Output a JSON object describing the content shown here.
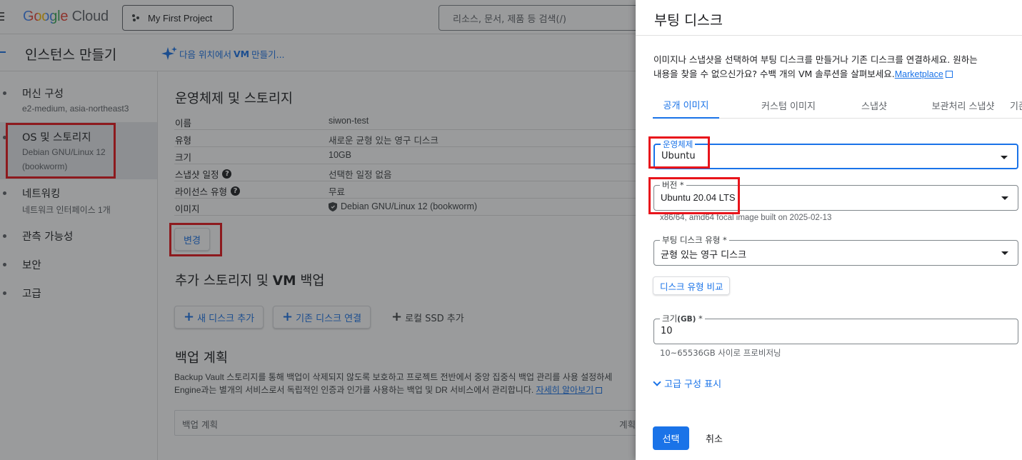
{
  "topbar": {
    "logo_google": "Google",
    "logo_cloud": "Cloud",
    "project": "My First Project",
    "search_placeholder": "리소스, 문서, 제품 등 검색(/)"
  },
  "subbar": {
    "title": "인스턴스 만들기",
    "ai_link_prefix": "다음 위치에서 ",
    "ai_link_bold": "VM",
    "ai_link_suffix": " 만들기..."
  },
  "leftnav": {
    "items": [
      {
        "title": "머신 구성",
        "sub": "e2-medium, asia-northeast3"
      },
      {
        "title": "OS 및 스토리지",
        "sub": "Debian GNU/Linux 12",
        "sub2": "(bookworm)"
      },
      {
        "title": "네트워킹",
        "sub": "네트워크 인터페이스 1개"
      },
      {
        "title": "관측 가능성"
      },
      {
        "title": "보안"
      },
      {
        "title": "고급"
      }
    ]
  },
  "content": {
    "os_title": "운영체제 및 스토리지",
    "specs": [
      {
        "key": "이름",
        "value": "siwon-test"
      },
      {
        "key": "유형",
        "value": "새로운 균형 있는 영구 디스크"
      },
      {
        "key": "크기",
        "value": "10GB"
      },
      {
        "key": "스냅샷 일정",
        "value": "선택한 일정 없음"
      },
      {
        "key": "라이선스 유형",
        "value": "무료"
      },
      {
        "key": "이미지",
        "value": "Debian GNU/Linux 12 (bookworm)"
      }
    ],
    "change_button": "변경",
    "storage_title_prefix": "추가 스토리지 및 ",
    "storage_title_bold": "VM",
    "storage_title_suffix": " 백업",
    "add_disk": "새 디스크 추가",
    "attach_disk": "기존 디스크 연결",
    "add_ssd": "로컬 SSD 추가",
    "backup_title": "백업 계획",
    "backup_desc_line1": "Backup Vault 스토리지를 통해 백업이 삭제되지 않도록 보호하고 프로젝트 전반에서 중앙 집중식 백업 관리를 사용 설정하세",
    "backup_desc_line2": "Engine과는 별개의 서비스로서 독립적인 인증과 인가를 사용하는 백업 및 DR 서비스에서 관리합니다.",
    "learn_more": "자세히 알아보기",
    "table_col1": "백업 계획",
    "table_col2": "계획"
  },
  "panel": {
    "title": "부팅 디스크",
    "desc_line1": "이미지나 스냅샷을 선택하여 부팅 디스크를 만들거나 기존 디스크를 연결하세요. 원하는",
    "desc_line2": "내용을 찾을 수 없으신가요? 수백 개의 VM 솔루션을 살펴보세요.",
    "marketplace": "Marketplace",
    "tabs": [
      "공개 이미지",
      "커스텀 이미지",
      "스냅샷",
      "보관처리 스냅샷",
      "기존"
    ],
    "os_label": "운영체제",
    "os_value": "Ubuntu",
    "version_label": "버전 *",
    "version_value": "Ubuntu 20.04 LTS",
    "version_hint": "x86/64, amd64 focal image built on 2025-02-13",
    "disk_type_label": "부팅 디스크 유형 *",
    "disk_type_value": "균형 있는 영구 디스크",
    "compare_button": "디스크 유형 비교",
    "size_label_prefix": "크기",
    "size_label_unit": "(GB)",
    "size_label_suffix": " *",
    "size_value": "10",
    "size_hint": "10~65536GB 사이로 프로비저닝",
    "advanced": "고급 구성 표시",
    "select_button": "선택",
    "cancel_button": "취소"
  },
  "colors": {
    "accent": "#1a73e8",
    "annotation_red": "#e8141b",
    "overlay": "rgba(32,33,36,0.45)"
  }
}
